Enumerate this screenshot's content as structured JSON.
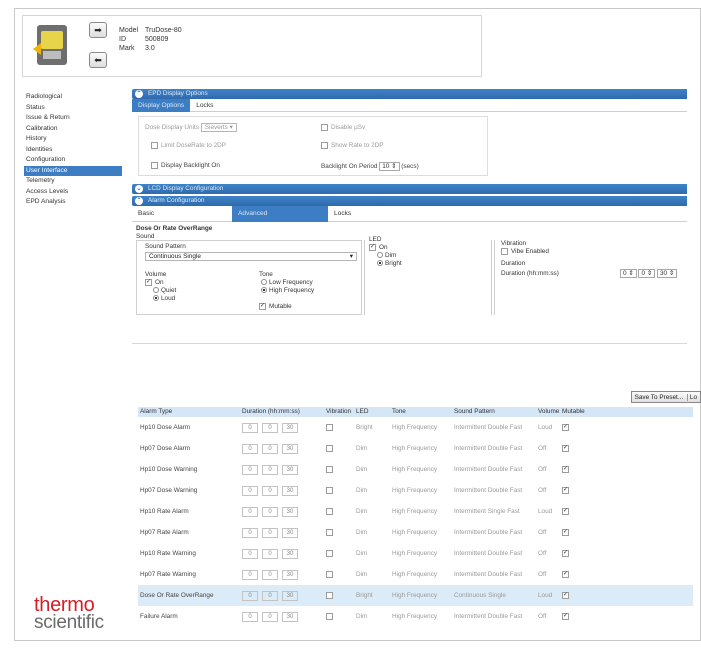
{
  "header": {
    "model_label": "Model",
    "model_value": "TruDose-80",
    "id_label": "ID",
    "id_value": "500809",
    "mark_label": "Mark",
    "mark_value": "3.0"
  },
  "sidebar": {
    "items": [
      {
        "label": "Radiological"
      },
      {
        "label": "Status"
      },
      {
        "label": "Issue & Return"
      },
      {
        "label": "Calibration"
      },
      {
        "label": "History"
      },
      {
        "label": "Identities"
      },
      {
        "label": "Configuration"
      },
      {
        "label": "User Interface"
      },
      {
        "label": "Telemetry"
      },
      {
        "label": "Access Levels"
      },
      {
        "label": "EPD Analysis"
      }
    ]
  },
  "epd_display": {
    "bar_title": "EPD Display Options",
    "tabs": [
      "Display Options",
      "Locks"
    ],
    "dose_units_label": "Dose Display Units",
    "dose_units_value": "Sieverts",
    "disable_usv_label": "Disable µSv",
    "limit_dose_label": "Limit DoseRate to 2DP",
    "show_rate_label": "Show Rate to 2DP",
    "backlight_label": "Display Backlight On",
    "backlight_period_label": "Backlight On Period",
    "backlight_period_value": "10",
    "backlight_period_unit": "(secs)"
  },
  "lcd_bar_title": "LCD Display Configuration",
  "alarm_cfg": {
    "bar_title": "Alarm Configuration",
    "tabs": [
      "Basic",
      "Advanced",
      "Locks"
    ],
    "title": "Dose Or Rate OverRange",
    "sound_label": "Sound",
    "sound_pattern_label": "Sound Pattern",
    "sound_pattern_value": "Continuous Single",
    "volume_label": "Volume",
    "vol_on": "On",
    "vol_quiet": "Quiet",
    "vol_loud": "Loud",
    "tone_label": "Tone",
    "tone_low": "Low Frequency",
    "tone_high": "High Frequency",
    "mutable_label": "Mutable",
    "led_label": "LED",
    "led_on": "On",
    "led_dim": "Dim",
    "led_bright": "Bright",
    "vibration_label": "Vibration",
    "vibe_enabled_label": "Vibe Enabled",
    "duration_label": "Duration",
    "duration_field_label": "Duration (hh:mm:ss)",
    "duration_values": [
      "0",
      "0",
      "30"
    ],
    "save_preset_label": "Save To Preset...",
    "save_preset_extra": "Lo"
  },
  "table": {
    "columns": [
      "Alarm Type",
      "Duration (hh:mm:ss)",
      "Vibration",
      "LED",
      "Tone",
      "Sound Pattern",
      "Volume",
      "Mutable"
    ],
    "rows": [
      {
        "type": "Hp10 Dose Alarm",
        "h": "0",
        "m": "0",
        "s": "30",
        "led": "Bright",
        "tone": "High Frequency",
        "pattern": "Intermittent Double Fast",
        "volume": "Loud"
      },
      {
        "type": "Hp07 Dose Alarm",
        "h": "0",
        "m": "0",
        "s": "30",
        "led": "Dim",
        "tone": "High Frequency",
        "pattern": "Intermittent Double Fast",
        "volume": "Off"
      },
      {
        "type": "Hp10 Dose Warning",
        "h": "0",
        "m": "0",
        "s": "30",
        "led": "Dim",
        "tone": "High Frequency",
        "pattern": "Intermittent Double Fast",
        "volume": "Off"
      },
      {
        "type": "Hp07 Dose Warning",
        "h": "0",
        "m": "0",
        "s": "30",
        "led": "Dim",
        "tone": "High Frequency",
        "pattern": "Intermittent Double Fast",
        "volume": "Off"
      },
      {
        "type": "Hp10 Rate Alarm",
        "h": "0",
        "m": "0",
        "s": "30",
        "led": "Dim",
        "tone": "High Frequency",
        "pattern": "Intermittent Single Fast",
        "volume": "Loud"
      },
      {
        "type": "Hp07 Rate Alarm",
        "h": "0",
        "m": "0",
        "s": "30",
        "led": "Dim",
        "tone": "High Frequency",
        "pattern": "Intermittent Double Fast",
        "volume": "Off"
      },
      {
        "type": "Hp10 Rate Warning",
        "h": "0",
        "m": "0",
        "s": "30",
        "led": "Dim",
        "tone": "High Frequency",
        "pattern": "Intermittent Double Fast",
        "volume": "Off"
      },
      {
        "type": "Hp07 Rate Warning",
        "h": "0",
        "m": "0",
        "s": "30",
        "led": "Dim",
        "tone": "High Frequency",
        "pattern": "Intermittent Double Fast",
        "volume": "Off"
      },
      {
        "type": "Dose Or Rate OverRange",
        "h": "0",
        "m": "0",
        "s": "30",
        "led": "Bright",
        "tone": "High Frequency",
        "pattern": "Continuous Single",
        "volume": "Loud"
      },
      {
        "type": "Failure Alarm",
        "h": "0",
        "m": "0",
        "s": "30",
        "led": "Dim",
        "tone": "High Frequency",
        "pattern": "Intermittent Double Fast",
        "volume": "Off"
      }
    ]
  },
  "logo": {
    "line1": "thermo",
    "line2": "scientific"
  },
  "colors": {
    "accent": "#3c7dc4",
    "brand_red": "#d41f26"
  }
}
